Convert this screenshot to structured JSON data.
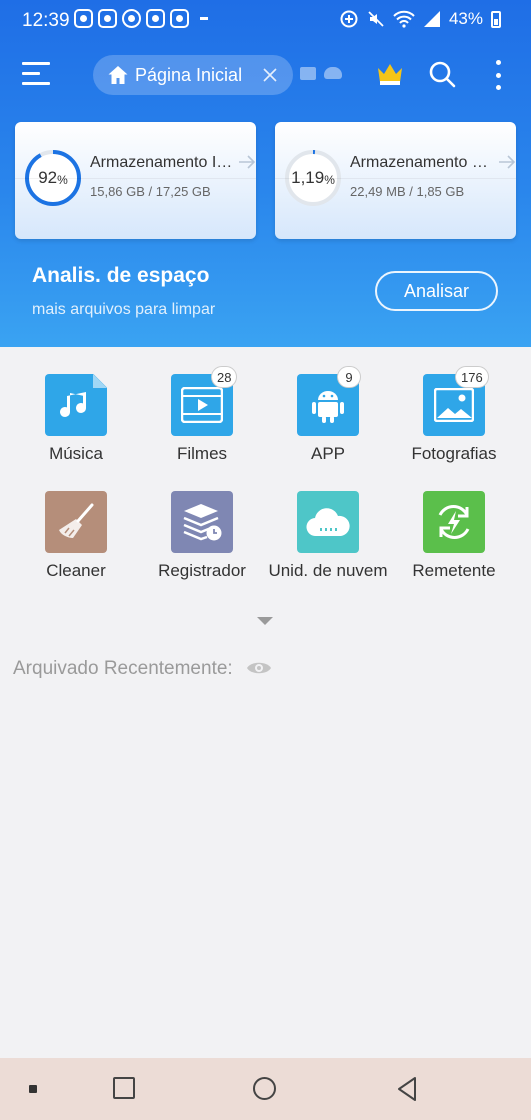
{
  "status_bar": {
    "time": "12:39",
    "battery": "43%"
  },
  "app_bar": {
    "tab_label": "Página Inicial"
  },
  "storage": [
    {
      "title": "Armazenamento Int…",
      "percent": "92",
      "percent_unit": "%",
      "fill": 0.92,
      "usage": "15,86 GB / 17,25 GB"
    },
    {
      "title": "Armazenamento Ex…",
      "percent": "1,19",
      "percent_unit": "%",
      "fill": 0.0119,
      "usage": "22,49 MB / 1,85 GB"
    }
  ],
  "analysis": {
    "title": "Analis. de espaço",
    "subtitle": "mais arquivos para limpar",
    "button": "Analisar"
  },
  "categories": [
    {
      "label": "Música",
      "icon": "music-note-icon",
      "badge": "",
      "color": "#2fa6e8"
    },
    {
      "label": "Filmes",
      "icon": "film-icon",
      "badge": "28",
      "color": "#2fa6e8"
    },
    {
      "label": "APP",
      "icon": "android-icon",
      "badge": "9",
      "color": "#2fa6e8"
    },
    {
      "label": "Fotografias",
      "icon": "image-icon",
      "badge": "176",
      "color": "#2fa6e8"
    },
    {
      "label": "Cleaner",
      "icon": "broom-icon",
      "badge": "",
      "color": "#b58e7a"
    },
    {
      "label": "Registrador",
      "icon": "stack-clock-icon",
      "badge": "",
      "color": "#7f87b3"
    },
    {
      "label": "Unid. de nuvem",
      "icon": "cloud-icon",
      "badge": "",
      "color": "#4ec6c8"
    },
    {
      "label": "Remetente",
      "icon": "sync-bolt-icon",
      "badge": "",
      "color": "#5bbf4b"
    }
  ],
  "recent": {
    "label": "Arquivado Recentemente:"
  }
}
